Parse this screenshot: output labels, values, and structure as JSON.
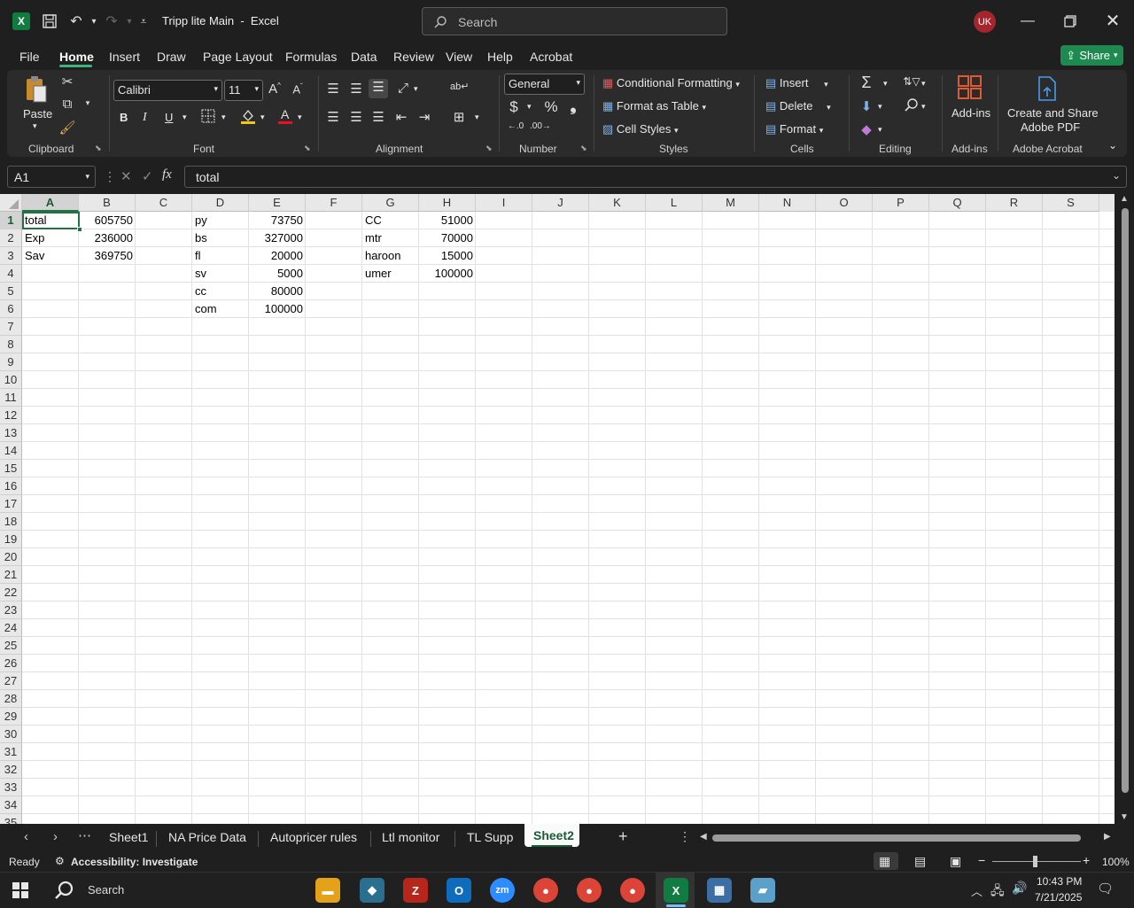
{
  "app": {
    "title": "Tripp lite Main  -  Excel",
    "search_placeholder": "Search",
    "user_initials": "UK",
    "logo_letter": "X"
  },
  "menu": {
    "tabs": [
      "File",
      "Home",
      "Insert",
      "Draw",
      "Page Layout",
      "Formulas",
      "Data",
      "Review",
      "View",
      "Help",
      "Acrobat"
    ],
    "active": "Home",
    "share_label": "Share"
  },
  "ribbon": {
    "clipboard": {
      "paste": "Paste",
      "label": "Clipboard"
    },
    "font": {
      "name": "Calibri",
      "size": "11",
      "label": "Font",
      "bold": "B",
      "italic": "I",
      "underline": "U"
    },
    "alignment": {
      "label": "Alignment"
    },
    "number": {
      "format": "General",
      "label": "Number"
    },
    "styles": {
      "conditional": "Conditional Formatting",
      "format_table": "Format as Table",
      "cell_styles": "Cell Styles",
      "label": "Styles"
    },
    "cells": {
      "insert": "Insert",
      "delete": "Delete",
      "format": "Format",
      "label": "Cells"
    },
    "editing": {
      "label": "Editing"
    },
    "addins": {
      "button": "Add-ins",
      "label": "Add-ins"
    },
    "acrobat": {
      "button_line1": "Create and Share",
      "button_line2": "Adobe PDF",
      "label": "Adobe Acrobat"
    }
  },
  "formula_bar": {
    "name_box": "A1",
    "formula": "total"
  },
  "sheet": {
    "columns": [
      "A",
      "B",
      "C",
      "D",
      "E",
      "F",
      "G",
      "H",
      "I",
      "J",
      "K",
      "L",
      "M",
      "N",
      "O",
      "P",
      "Q",
      "R",
      "S"
    ],
    "rows": [
      "1",
      "2",
      "3",
      "4",
      "5",
      "6",
      "7",
      "8",
      "9",
      "10",
      "11",
      "12",
      "13",
      "14",
      "15",
      "16",
      "17",
      "18",
      "19",
      "20",
      "21",
      "22",
      "23",
      "24",
      "25",
      "26",
      "27",
      "28",
      "29",
      "30",
      "31",
      "32",
      "33",
      "34",
      "35"
    ],
    "selected_cell": "A1",
    "cells": [
      {
        "ref": "A1",
        "value": "total",
        "type": "text"
      },
      {
        "ref": "B1",
        "value": "605750",
        "type": "num"
      },
      {
        "ref": "A2",
        "value": "Exp",
        "type": "text"
      },
      {
        "ref": "B2",
        "value": "236000",
        "type": "num"
      },
      {
        "ref": "A3",
        "value": "Sav",
        "type": "text"
      },
      {
        "ref": "B3",
        "value": "369750",
        "type": "num"
      },
      {
        "ref": "D1",
        "value": "py",
        "type": "text"
      },
      {
        "ref": "E1",
        "value": "73750",
        "type": "num"
      },
      {
        "ref": "D2",
        "value": "bs",
        "type": "text"
      },
      {
        "ref": "E2",
        "value": "327000",
        "type": "num"
      },
      {
        "ref": "D3",
        "value": "fl",
        "type": "text"
      },
      {
        "ref": "E3",
        "value": "20000",
        "type": "num"
      },
      {
        "ref": "D4",
        "value": "sv",
        "type": "text"
      },
      {
        "ref": "E4",
        "value": "5000",
        "type": "num"
      },
      {
        "ref": "D5",
        "value": "cc",
        "type": "text"
      },
      {
        "ref": "E5",
        "value": "80000",
        "type": "num"
      },
      {
        "ref": "D6",
        "value": "com",
        "type": "text"
      },
      {
        "ref": "E6",
        "value": "100000",
        "type": "num"
      },
      {
        "ref": "G1",
        "value": "CC",
        "type": "text"
      },
      {
        "ref": "H1",
        "value": "51000",
        "type": "num"
      },
      {
        "ref": "G2",
        "value": "mtr",
        "type": "text"
      },
      {
        "ref": "H2",
        "value": "70000",
        "type": "num"
      },
      {
        "ref": "G3",
        "value": "haroon",
        "type": "text"
      },
      {
        "ref": "H3",
        "value": "15000",
        "type": "num"
      },
      {
        "ref": "G4",
        "value": "umer",
        "type": "text"
      },
      {
        "ref": "H4",
        "value": "100000",
        "type": "num"
      }
    ]
  },
  "sheet_tabs": {
    "tabs": [
      "Sheet1",
      "NA Price Data",
      "Autopricer rules",
      "Ltl monitor",
      "TL Supp",
      "Sheet2"
    ],
    "active": "Sheet2"
  },
  "status": {
    "ready": "Ready",
    "accessibility": "Accessibility: Investigate",
    "zoom": "100%"
  },
  "taskbar": {
    "search_placeholder": "Search",
    "time": "10:43 PM",
    "date": "7/21/2025"
  }
}
